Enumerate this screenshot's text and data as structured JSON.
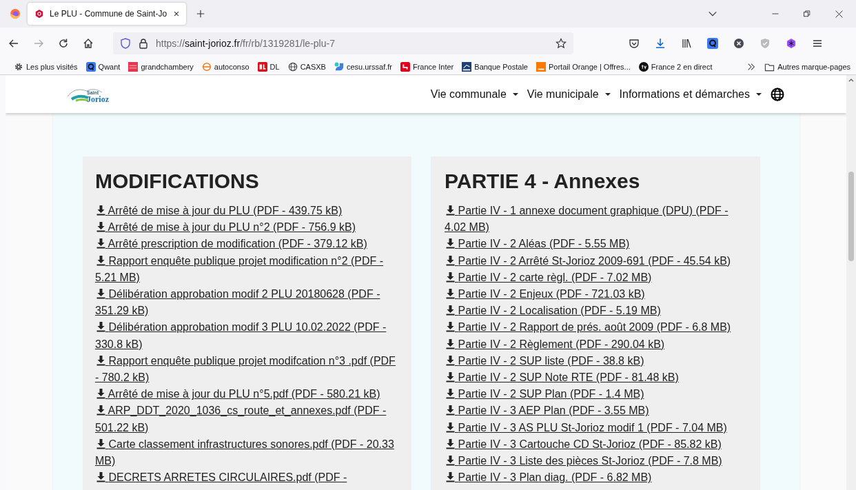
{
  "browser": {
    "tab": {
      "title": "Le PLU - Commune de Saint-Jo",
      "selected": true
    },
    "url": {
      "scheme": "https://",
      "domain": "saint-jorioz.fr",
      "path": "/fr/rb/1319281/le-plu-7"
    },
    "bookmarks": [
      {
        "label": "Les plus visités"
      },
      {
        "label": "Qwant"
      },
      {
        "label": "grandchambery"
      },
      {
        "label": "autoconso"
      },
      {
        "label": "DL"
      },
      {
        "label": "CASXB"
      },
      {
        "label": "cesu.urssaf.fr"
      },
      {
        "label": "France Inter"
      },
      {
        "label": "Banque Postale"
      },
      {
        "label": "Portail Orange | Offres..."
      },
      {
        "label": "France 2 en direct"
      }
    ],
    "other_bookmarks": "Autres marque-pages"
  },
  "site": {
    "logo": {
      "line1": "Saint",
      "line2": "Jorioz"
    },
    "nav": [
      "Vie communale",
      "Vie municipale",
      "Informations et démarches"
    ]
  },
  "sections": [
    {
      "title": "MODIFICATIONS",
      "links": [
        "Arrêté de mise à jour du PLU (PDF - 439.75 kB)",
        "Arrêté de mise à jour du PLU n°2 (PDF - 756.9 kB)",
        "Arrêté prescription de modification (PDF - 379.12 kB)",
        "Rapport enquête publique projet modification n°2 (PDF - 5.21 MB)",
        "Délibération approbation modif 2 PLU 20180628 (PDF - 351.29 kB)",
        "Délibération approbation modif 3 PLU 10.02.2022 (PDF - 330.8 kB)",
        "Rapport enquête publique projet modifcation n°3 .pdf (PDF - 780.2 kB)",
        "Arrêté de mise à jour du PLU n°5.pdf (PDF - 580.21 kB)",
        "ARP_DDT_2020_1036_cs_route_et_annexes.pdf (PDF - 501.22 kB)",
        "Carte classement infrastructures sonores.pdf (PDF - 20.33 MB)",
        "DECRETS ARRETES CIRCULAIRES.pdf (PDF -"
      ]
    },
    {
      "title": "PARTIE 4 - Annexes",
      "links": [
        "Partie IV - 1 annexe document graphique (DPU) (PDF - 4.02 MB)",
        "Partie IV - 2 Aléas (PDF - 5.55 MB)",
        "Partie IV - 2 Arrêté St-Jorioz 2009-691 (PDF - 45.54 kB)",
        "Partie IV - 2 carte règl. (PDF - 7.02 MB)",
        "Partie IV - 2 Enjeux (PDF - 721.03 kB)",
        "Partie IV - 2 Localisation (PDF - 5.19 MB)",
        "Partie IV - 2 Rapport de prés. août 2009 (PDF - 6.8 MB)",
        "Partie IV - 2 Règlement (PDF - 290.04 kB)",
        "Partie IV - 2 SUP liste (PDF - 38.8 kB)",
        "Partie IV - 2 SUP Note RTE (PDF - 81.48 kB)",
        "Partie IV - 2 SUP Plan (PDF - 1.4 MB)",
        "Partie IV - 3 AEP Plan (PDF - 3.55 MB)",
        "Partie IV - 3 AS PLU St-Jorioz modif 1 (PDF - 7.04 MB)",
        "Partie IV - 3 Cartouche CD St-Jorioz (PDF - 85.82 kB)",
        "Partie IV - 3 Liste des pièces St-Jorioz (PDF - 7.8 MB)",
        "Partie IV - 3 Plan diag. (PDF - 6.82 MB)"
      ]
    }
  ]
}
